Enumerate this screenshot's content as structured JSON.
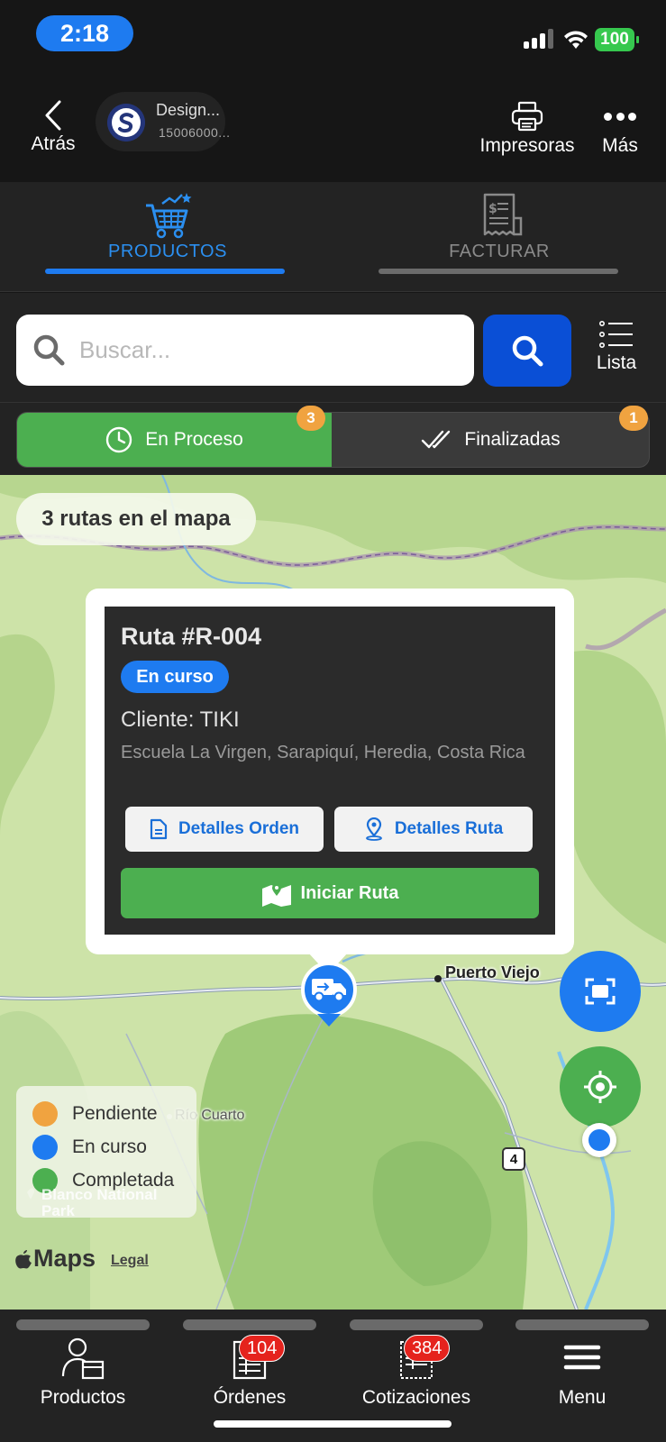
{
  "status_bar": {
    "time": "2:18",
    "battery": "100"
  },
  "header": {
    "back_label": "Atrás",
    "company_name": "Design...",
    "company_id": "15006000...",
    "printers_label": "Impresoras",
    "more_label": "Más"
  },
  "module_tabs": [
    {
      "label": "PRODUCTOS",
      "active": true,
      "icon": "cart-icon"
    },
    {
      "label": "FACTURAR",
      "active": false,
      "icon": "invoice-icon"
    }
  ],
  "search": {
    "placeholder": "Buscar...",
    "value": "",
    "list_label": "Lista"
  },
  "segments": {
    "in_process": {
      "label": "En Proceso",
      "count": "3"
    },
    "finished": {
      "label": "Finalizadas",
      "count": "1"
    }
  },
  "map": {
    "routes_count_label": "3 rutas en el mapa",
    "place_labels": {
      "puerto_viejo": "Puerto Viejo",
      "rio_cuarto": "Río Cuarto",
      "park": "Blanco National Park",
      "route_number": "4"
    },
    "legend": [
      {
        "label": "Pendiente",
        "color": "#f0a340"
      },
      {
        "label": "En curso",
        "color": "#1e7bf0"
      },
      {
        "label": "Completada",
        "color": "#4caf50"
      }
    ],
    "maps_brand": "Maps",
    "legal": "Legal"
  },
  "callout": {
    "title": "Ruta #R-004",
    "status": "En curso",
    "client": "Cliente: TIKI",
    "address": "Escuela La Virgen, Sarapiquí, Heredia, Costa Rica",
    "order_details": "Detalles Orden",
    "route_details": "Detalles Ruta",
    "start_route": "Iniciar Ruta"
  },
  "bottom_nav": [
    {
      "label": "Productos",
      "badge": null
    },
    {
      "label": "Órdenes",
      "badge": "104"
    },
    {
      "label": "Cotizaciones",
      "badge": "384"
    },
    {
      "label": "Menu",
      "badge": null
    }
  ],
  "colors": {
    "accent_blue": "#1e7bf0",
    "success_green": "#4caf50",
    "badge_orange": "#f0a340",
    "badge_red": "#e5231d"
  }
}
